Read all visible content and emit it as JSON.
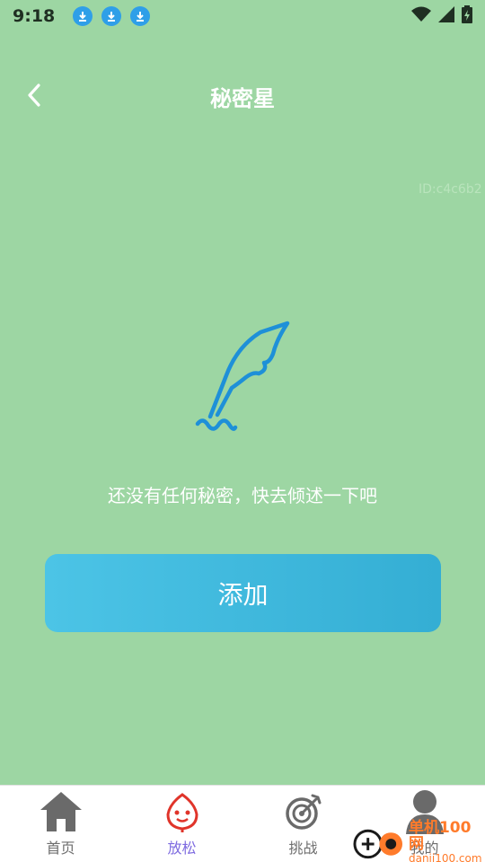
{
  "status": {
    "time": "9:18"
  },
  "header": {
    "title": "秘密星"
  },
  "debug_id": "ID:c4c6b2",
  "empty_state": {
    "message": "还没有任何秘密，快去倾述一下吧"
  },
  "add_button": {
    "label": "添加"
  },
  "tabs": [
    {
      "label": "首页",
      "icon": "home-icon"
    },
    {
      "label": "放松",
      "icon": "leaf-face-icon"
    },
    {
      "label": "挑战",
      "icon": "target-icon"
    },
    {
      "label": "我的",
      "icon": "user-icon"
    }
  ],
  "watermark": {
    "cn": "单机100网",
    "en": "danji100.com"
  },
  "colors": {
    "background": "#9dd6a3",
    "accent": "#3bb5dc",
    "active_tab": "#7e6be0",
    "feather": "#1e90d8"
  }
}
